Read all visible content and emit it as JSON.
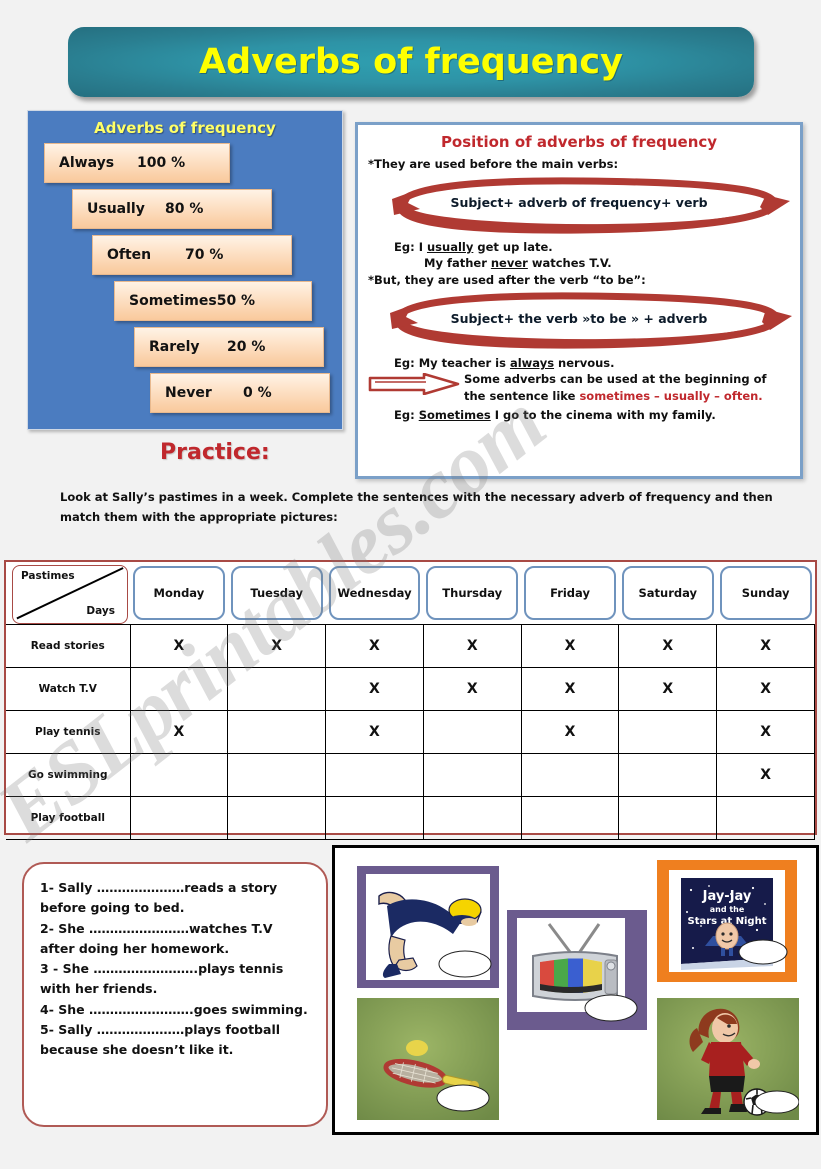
{
  "page": {
    "title": "Adverbs of frequency",
    "watermark": "ESLprintables.com"
  },
  "frequency_panel": {
    "header": "Adverbs of frequency",
    "steps": [
      {
        "label": "Always",
        "percent": "100 %"
      },
      {
        "label": "Usually",
        "percent": "80 %"
      },
      {
        "label": "Often",
        "percent": "70 %"
      },
      {
        "label": "Sometimes",
        "percent": "50 %"
      },
      {
        "label": "Rarely",
        "percent": "20 %"
      },
      {
        "label": "Never",
        "percent": "0 %"
      }
    ]
  },
  "position_panel": {
    "header": "Position of adverbs of frequency",
    "rule1": "*They are used before the main verbs:",
    "formula1": "Subject+ adverb of frequency+ verb",
    "eg1a_prefix": "Eg: I ",
    "eg1a_underline": "usually",
    "eg1a_suffix": " get up late.",
    "eg1b_prefix": "My father ",
    "eg1b_underline": "never",
    "eg1b_suffix": " watches T.V.",
    "rule2": "*But, they are used after the verb “to be”:",
    "formula2": "Subject+ the verb »to be » + adverb",
    "eg2_prefix": "Eg: My teacher is ",
    "eg2_underline": "always",
    "eg2_suffix": " nervous.",
    "note_part1": "Some adverbs can be used at the beginning of the sentence like ",
    "note_highlight": "sometimes – usually – often.",
    "eg3_prefix": "Eg: ",
    "eg3_underline": "Sometimes",
    "eg3_suffix": " I go to the cinema with my family."
  },
  "practice": {
    "heading": "Practice:",
    "instructions": "Look at Sally’s pastimes in a week.  Complete the sentences with the necessary adverb of frequency and then match them with the appropriate pictures:"
  },
  "table": {
    "corner_top": "Pastimes",
    "corner_bottom": "Days",
    "days": [
      "Monday",
      "Tuesday",
      "Wednesday",
      "Thursday",
      "Friday",
      "Saturday",
      "Sunday"
    ],
    "mark": "X",
    "rows": [
      {
        "label": "Read stories",
        "marks": [
          true,
          true,
          true,
          true,
          true,
          true,
          true
        ]
      },
      {
        "label": "Watch T.V",
        "marks": [
          false,
          false,
          true,
          true,
          true,
          true,
          true
        ]
      },
      {
        "label": "Play tennis",
        "marks": [
          true,
          false,
          true,
          false,
          true,
          false,
          true
        ]
      },
      {
        "label": "Go swimming",
        "marks": [
          false,
          false,
          false,
          false,
          false,
          false,
          true
        ]
      },
      {
        "label": "Play football",
        "marks": [
          false,
          false,
          false,
          false,
          false,
          false,
          false
        ]
      }
    ]
  },
  "sentences": {
    "items": [
      "1- Sally …………………reads a story before going to bed.",
      "2- She ……………………watches T.V after doing her homework.",
      "3 - She …………………….plays tennis with her friends.",
      "4- She …………………….goes swimming.",
      "5- Sally …………………plays football because she doesn’t like it."
    ]
  },
  "pictures": {
    "items": [
      {
        "name": "swimming",
        "frame_color": "#6b5b8e"
      },
      {
        "name": "television",
        "frame_color": "#6b5b8e"
      },
      {
        "name": "reading-book",
        "frame_color": "#ef7f1f",
        "book_title_line1": "Jay-Jay",
        "book_title_line2": "and the",
        "book_title_line3": "Stars at Night"
      },
      {
        "name": "tennis",
        "frame_color": "#7f9e4e"
      },
      {
        "name": "football",
        "frame_color": "#7f9e4e"
      }
    ]
  },
  "colors": {
    "banner_teal": "#2e93a6",
    "banner_text": "#ffff00",
    "panel_blue": "#4b7cc0",
    "step_peach": "#f9c99c",
    "heading_red": "#c0282d",
    "table_border_red": "#a84a45",
    "day_border_blue": "#6f93bd"
  }
}
